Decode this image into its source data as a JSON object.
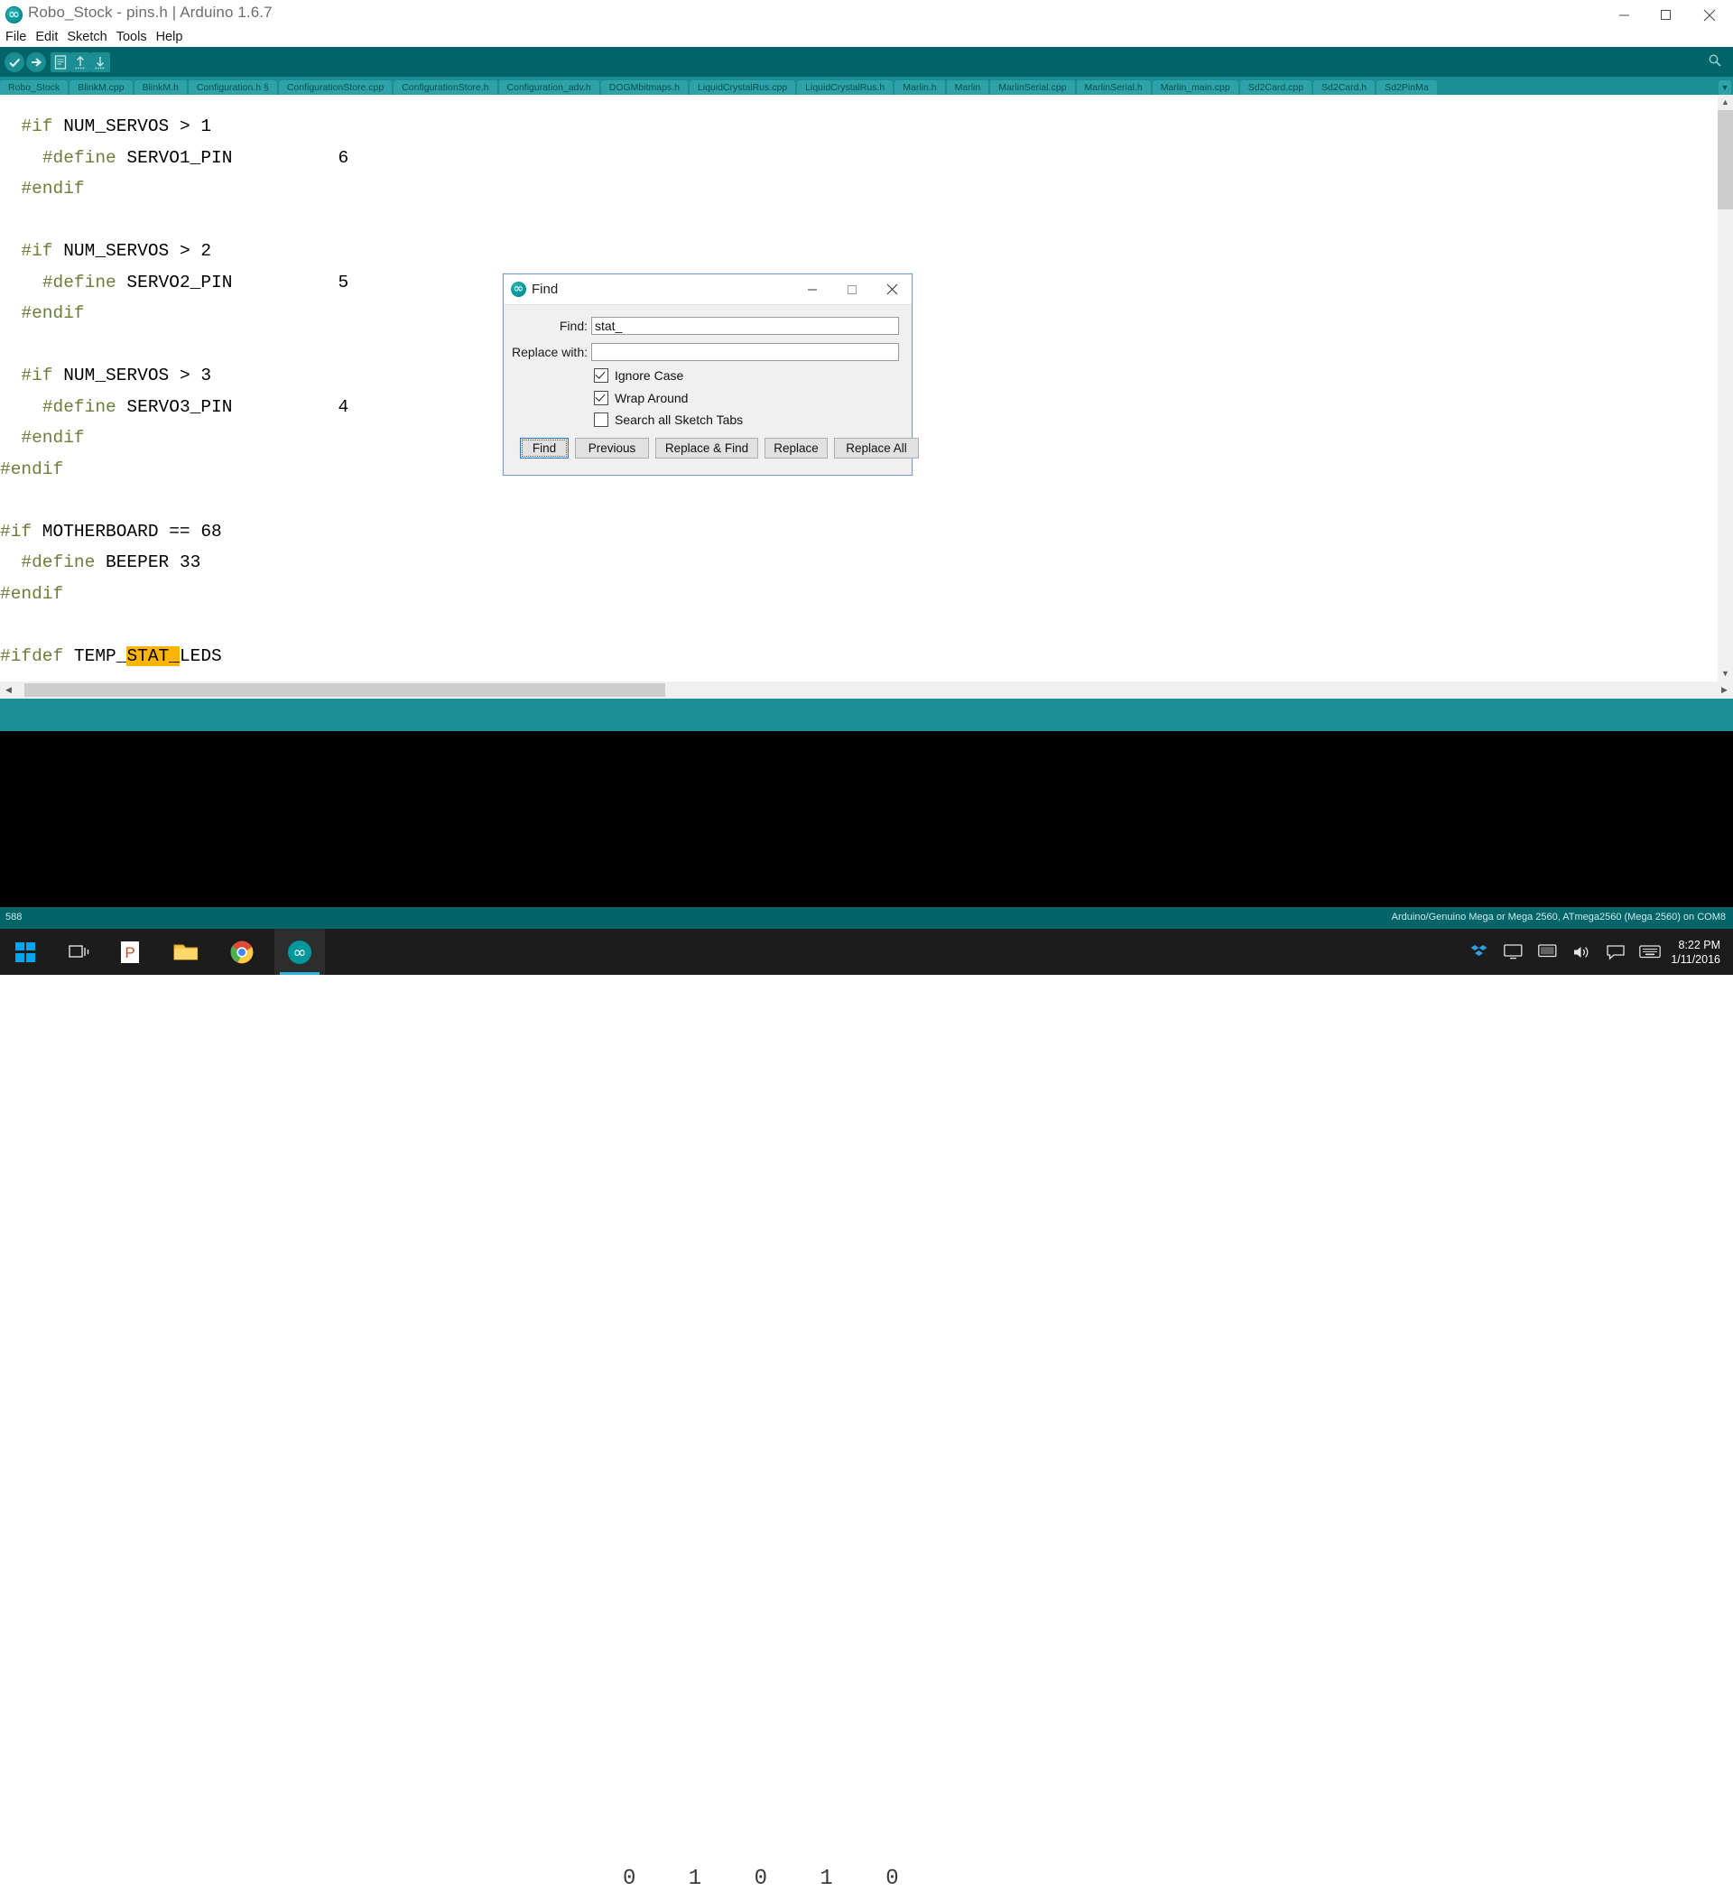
{
  "window": {
    "title": "Robo_Stock - pins.h | Arduino 1.6.7",
    "app_icon": "arduino-icon",
    "minimize": "–",
    "maximize": "▢",
    "close": "✕"
  },
  "menubar": {
    "items": [
      "File",
      "Edit",
      "Sketch",
      "Tools",
      "Help"
    ]
  },
  "toolbar": {
    "buttons": [
      {
        "name": "verify-button",
        "icon": "check-icon"
      },
      {
        "name": "upload-button",
        "icon": "arrow-right-icon"
      },
      {
        "name": "new-button",
        "icon": "new-file-icon"
      },
      {
        "name": "open-button",
        "icon": "open-folder-icon"
      },
      {
        "name": "save-button",
        "icon": "save-icon"
      }
    ],
    "serial_monitor_icon": "magnifier-icon"
  },
  "tabs": {
    "items": [
      "Robo_Stock",
      "BlinkM.cpp",
      "BlinkM.h",
      "Configuration.h §",
      "ConfigurationStore.cpp",
      "ConfigurationStore.h",
      "Configuration_adv.h",
      "DOGMbitmaps.h",
      "LiquidCrystalRus.cpp",
      "LiquidCrystalRus.h",
      "Marlin.h",
      "Marlin",
      "MarlinSerial.cpp",
      "MarlinSerial.h",
      "Marlin_main.cpp",
      "Sd2Card.cpp",
      "Sd2Card.h",
      "Sd2PinMa"
    ],
    "overflow_icon": "chevron-down-icon"
  },
  "editor": {
    "lines": [
      [
        {
          "t": "  ",
          "c": "p"
        },
        {
          "t": "#if",
          "c": "kw"
        },
        {
          "t": " NUM_SERVOS > 1",
          "c": "p"
        }
      ],
      [
        {
          "t": "    ",
          "c": "p"
        },
        {
          "t": "#define",
          "c": "kw"
        },
        {
          "t": " SERVO1_PIN          6",
          "c": "p"
        }
      ],
      [
        {
          "t": "  ",
          "c": "p"
        },
        {
          "t": "#endif",
          "c": "kw"
        }
      ],
      [],
      [
        {
          "t": "  ",
          "c": "p"
        },
        {
          "t": "#if",
          "c": "kw"
        },
        {
          "t": " NUM_SERVOS > 2",
          "c": "p"
        }
      ],
      [
        {
          "t": "    ",
          "c": "p"
        },
        {
          "t": "#define",
          "c": "kw"
        },
        {
          "t": " SERVO2_PIN          5",
          "c": "p"
        }
      ],
      [
        {
          "t": "  ",
          "c": "p"
        },
        {
          "t": "#endif",
          "c": "kw"
        }
      ],
      [],
      [
        {
          "t": "  ",
          "c": "p"
        },
        {
          "t": "#if",
          "c": "kw"
        },
        {
          "t": " NUM_SERVOS > 3",
          "c": "p"
        }
      ],
      [
        {
          "t": "    ",
          "c": "p"
        },
        {
          "t": "#define",
          "c": "kw"
        },
        {
          "t": " SERVO3_PIN          4",
          "c": "p"
        }
      ],
      [
        {
          "t": "  ",
          "c": "p"
        },
        {
          "t": "#endif",
          "c": "kw"
        }
      ],
      [
        {
          "t": "#endif",
          "c": "kw"
        }
      ],
      [],
      [
        {
          "t": "#if",
          "c": "kw"
        },
        {
          "t": " MOTHERBOARD == 68",
          "c": "p"
        }
      ],
      [
        {
          "t": "  ",
          "c": "p"
        },
        {
          "t": "#define",
          "c": "kw"
        },
        {
          "t": " BEEPER 33",
          "c": "p"
        }
      ],
      [
        {
          "t": "#endif",
          "c": "kw"
        }
      ],
      [],
      [
        {
          "t": "#ifdef",
          "c": "kw"
        },
        {
          "t": " TEMP_",
          "c": "p"
        },
        {
          "t": "STAT_",
          "c": "hl"
        },
        {
          "t": "LEDS",
          "c": "p"
        }
      ]
    ],
    "scroll_left_icon": "chevron-left-icon",
    "scroll_right_icon": "chevron-right-icon",
    "scroll_up_icon": "chevron-up-icon",
    "scroll_down_icon": "chevron-down-icon"
  },
  "statusbar": {
    "line_number": "588",
    "board_info": "Arduino/Genuino Mega or Mega 2560, ATmega2560 (Mega 2560) on COM8"
  },
  "find_dialog": {
    "title": "Find",
    "app_icon": "arduino-icon",
    "minimize": "–",
    "maximize": "▢",
    "close": "✕",
    "find_label": "Find:",
    "find_value": "stat_",
    "replace_label": "Replace with:",
    "replace_value": "",
    "checkboxes": [
      {
        "label": "Ignore Case",
        "checked": true
      },
      {
        "label": "Wrap Around",
        "checked": true
      },
      {
        "label": "Search all Sketch Tabs",
        "checked": false
      }
    ],
    "buttons": [
      "Find",
      "Previous",
      "Replace & Find",
      "Replace",
      "Replace All"
    ],
    "default_button": "Find"
  },
  "taskbar": {
    "start_icon": "windows-logo-icon",
    "items": [
      {
        "name": "task-view",
        "icon": "task-view-icon"
      },
      {
        "name": "powerpoint",
        "icon": "powerpoint-icon",
        "glyph": "P"
      },
      {
        "name": "file-explorer",
        "icon": "folder-icon"
      },
      {
        "name": "chrome",
        "icon": "chrome-icon"
      },
      {
        "name": "arduino",
        "icon": "arduino-icon",
        "active": true
      }
    ],
    "tray_icons": [
      "dropbox-icon",
      "display-icon",
      "monitor-icon",
      "volume-icon",
      "action-center-icon",
      "keyboard-icon"
    ],
    "clock_time": "8:22 PM",
    "clock_date": "1/11/2016",
    "watermark": "0 1 0 1 0"
  },
  "colors": {
    "teal_dark": "#006468",
    "teal": "#1a8e93",
    "teal_tab": "#2da3a8",
    "keyword": "#6d7e39",
    "highlight": "#ffb400",
    "taskbar": "#1c1c1c"
  }
}
